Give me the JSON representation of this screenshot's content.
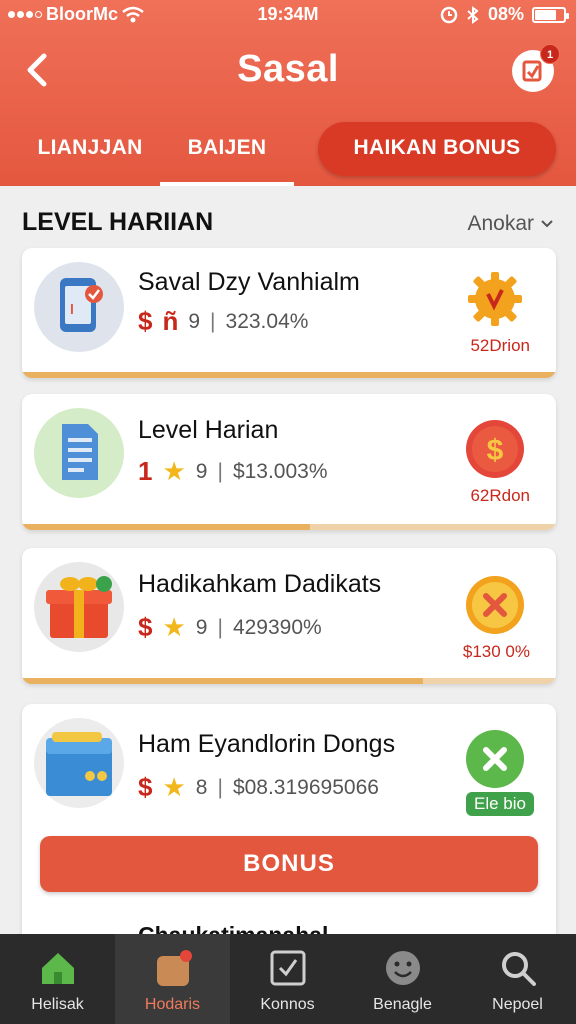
{
  "status_bar": {
    "carrier": "BloorMc",
    "time": "19:34M",
    "battery_percent": "08%"
  },
  "header": {
    "title": "Sasal",
    "notification_count": "1"
  },
  "tabs": [
    {
      "label": "LIANJJAN"
    },
    {
      "label": "BAIJEN"
    },
    {
      "label": "HAIKAN BONUS"
    }
  ],
  "section": {
    "title": "LEVEL HARIIAN",
    "sort_label": "Anokar"
  },
  "cards": [
    {
      "title": "Saval Dzy Vanhialm",
      "meta_left": "ñ",
      "meta_count": "9",
      "meta_amount": "323.04%",
      "reward_label": "52Drion",
      "progress": 1.0,
      "reward_icon": "gear-icon"
    },
    {
      "title": "Level Harian",
      "meta_left": "1",
      "meta_count": "9",
      "meta_amount": "$13.003%",
      "reward_label": "62Rdon",
      "progress": 0.54,
      "reward_icon": "dollar-coin-icon"
    },
    {
      "title": "Hadikahkam Dadikats",
      "meta_left": "$",
      "meta_count": "9",
      "meta_amount": "429390%",
      "reward_label": "$130 0%",
      "progress": 0.75,
      "reward_icon": "x-coin-icon"
    },
    {
      "title": "Ham Eyandlorin Dongs",
      "meta_left": "$",
      "meta_count": "8",
      "meta_amount": "$08.319695066",
      "reward_label": "Ele bio",
      "reward_icon": "x-green-icon"
    }
  ],
  "bonus_button": "BONUS",
  "peek_title": "Chaukatimanahal",
  "bottom_nav": [
    {
      "label": "Helisak"
    },
    {
      "label": "Hodaris"
    },
    {
      "label": "Konnos"
    },
    {
      "label": "Benagle"
    },
    {
      "label": "Nepoel"
    }
  ],
  "colors": {
    "brand": "#e4573f",
    "accent_dark": "#c8281c",
    "nav_bg": "#2b2b2b",
    "success": "#3fa24a"
  }
}
